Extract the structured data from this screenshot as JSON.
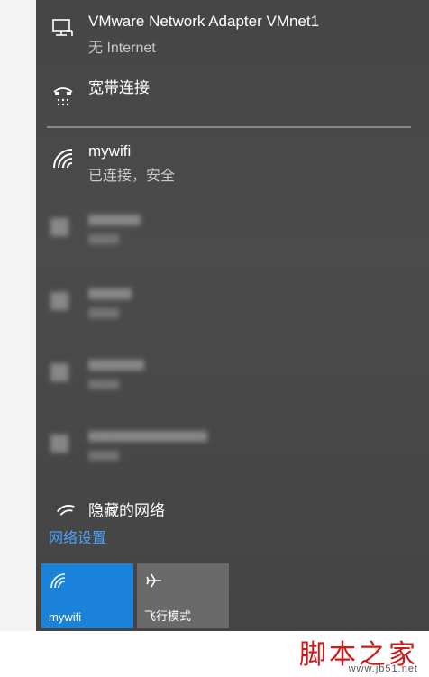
{
  "network_list": {
    "vmware": {
      "name": "VMware Network Adapter VMnet1",
      "status": "无 Internet",
      "icon": "ethernet-icon"
    },
    "broadband": {
      "name": "宽带连接",
      "icon": "dialup-icon"
    },
    "connected": {
      "name": "mywifi",
      "status": "已连接，安全",
      "icon": "wifi-icon"
    },
    "hidden": {
      "name": "隐藏的网络",
      "icon": "wifi-icon"
    }
  },
  "settings_link": "网络设置",
  "quick_actions": {
    "wifi": {
      "label": "mywifi",
      "icon": "wifi-icon",
      "state": "on"
    },
    "airplane": {
      "label": "飞行模式",
      "icon": "airplane-icon",
      "state": "off"
    }
  },
  "watermark": {
    "title": "脚本之家",
    "url": "www.jb51.net"
  },
  "colors": {
    "panel_bg": "#4a4a4a",
    "accent": "#1a82d8",
    "link": "#4aa3ff",
    "watermark": "#d01818"
  }
}
